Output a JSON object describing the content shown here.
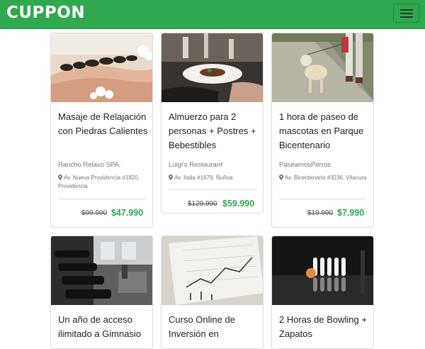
{
  "header": {
    "brand": "CUPPON",
    "menu_icon": "hamburger-menu-icon"
  },
  "colors": {
    "brand_green": "#2fa84f",
    "price_green": "#2fa84f"
  },
  "deals": [
    {
      "title": "Masaje de Relajación con Piedras Calientes",
      "merchant": "Rancho Relaxo SPA.",
      "address": "Av. Nueva Providencia #1820, Providencia",
      "old_price": "$99.990",
      "price": "$47.990",
      "image_icon": "hot-stone-massage-photo"
    },
    {
      "title": "Almuerzo para 2 personas + Postres + Bebestibles",
      "merchant": "Luigi's Restaurant",
      "address": "Av. Italia #1679, Ñuñoa",
      "old_price": "$129.990",
      "price": "$59.990",
      "image_icon": "restaurant-dish-photo"
    },
    {
      "title": "1 hora de paseo de mascotas en Parque Bicentenario",
      "merchant": "PaseamosPerros",
      "address": "Av. Bicentenario #3236, Vitacura",
      "old_price": "$19.990",
      "price": "$7.990",
      "image_icon": "dog-walking-photo"
    },
    {
      "title": "Un año de acceso ilimitado a Gimnasio",
      "image_icon": "gym-dumbbells-photo"
    },
    {
      "title": "Curso Online de Inversión en",
      "image_icon": "stock-chart-paper-photo"
    },
    {
      "title": "2 Horas de Bowling + Zapatos",
      "image_icon": "bowling-pins-photo"
    }
  ]
}
